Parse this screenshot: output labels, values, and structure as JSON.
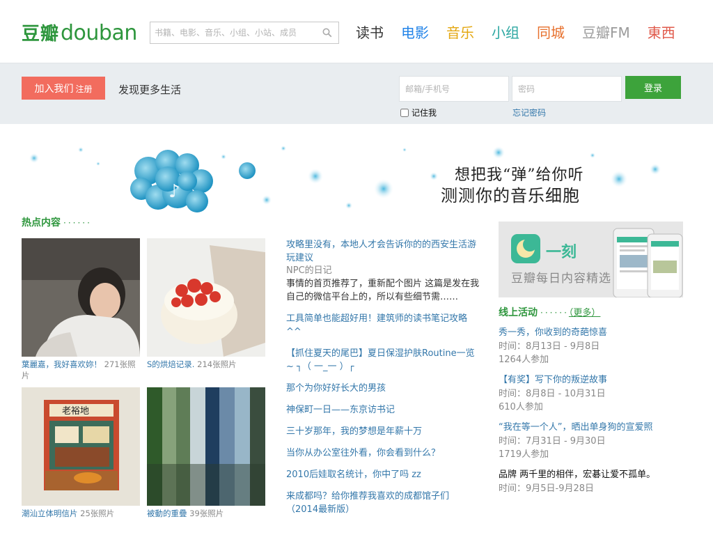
{
  "brand": {
    "logo_cn": "豆瓣",
    "logo_en_1": "douban",
    "color": "#2e963d"
  },
  "search": {
    "placeholder": "书籍、电影、音乐、小组、小站、成员"
  },
  "nav": [
    {
      "label": "读书",
      "color": "#333333"
    },
    {
      "label": "电影",
      "color": "#2384e8"
    },
    {
      "label": "音乐",
      "color": "#e4a813"
    },
    {
      "label": "小组",
      "color": "#2ca7a2"
    },
    {
      "label": "同城",
      "color": "#e76f2b"
    },
    {
      "label": "豆瓣FM",
      "color": "#9b9b9b"
    },
    {
      "label": "東西",
      "color": "#e05a4b"
    }
  ],
  "joinbar": {
    "join_label": "加入我们",
    "join_small": "注册",
    "tagline": "发现更多生活",
    "email_placeholder": "邮箱/手机号",
    "password_placeholder": "密码",
    "login_label": "登录",
    "remember_label": "记住我",
    "forgot_label": "忘记密码"
  },
  "banner": {
    "line1": "想把我“弹”给你听",
    "line2": "测测你的音乐细胞"
  },
  "hot": {
    "title": "热点内容",
    "dots": "······",
    "photos": [
      {
        "title": "葉麗嘉，我好喜欢妳！",
        "count": "271张照片"
      },
      {
        "title": "S的烘焙记录.",
        "count": "214张照片"
      },
      {
        "title": "潮汕立体明信片",
        "count": "25张照片"
      },
      {
        "title": "被動的重疊",
        "count": "39张照片"
      }
    ],
    "articles": [
      {
        "title": "攻略里没有，本地人才会告诉你的的西安生活游玩建议",
        "source": "NPC的日记",
        "desc": "事情的首页推荐了，重新配个图片 这篇是发在我自己的微信平台上的，所以有些细节需……"
      },
      {
        "title": "工具简单也能超好用！建筑师的读书笔记攻略^^"
      },
      {
        "title": "【抓住夏天的尾巴】夏日保湿护肤Routine一览~ ┐（ 一_一 ）┌"
      },
      {
        "title": "那个为你好好长大的男孩"
      },
      {
        "title": "神保町一日——东京访书记"
      },
      {
        "title": "三十岁那年，我的梦想是年薪十万"
      },
      {
        "title": "当你从办公室往外看，你会看到什么？"
      },
      {
        "title": "2010后娃取名统计，你中了吗 zz"
      },
      {
        "title": "来成都吗？给你推荐我喜欢的成都馆子们（2014最新版）"
      }
    ]
  },
  "ad": {
    "brand": "一刻",
    "slogan": "豆瓣每日内容精选"
  },
  "activities": {
    "title": "线上活动",
    "dots": "······",
    "more": "（更多）",
    "items": [
      {
        "title": "秀一秀，你收到的奇葩惊喜",
        "time": "时间：8月13日 - 9月8日",
        "count": "1264人参加"
      },
      {
        "title": "【有奖】写下你的叛逆故事",
        "time": "时间：8月8日 - 10月31日",
        "count": "610人参加"
      },
      {
        "title": "“我在等一个人”，晒出单身狗的宣爱照",
        "time": "时间：7月31日 - 9月30日",
        "count": "1719人参加"
      },
      {
        "title": "品牌  两千里的相伴，宏碁让爱不孤单。",
        "time": "时间：9月5日-9月28日"
      }
    ]
  }
}
